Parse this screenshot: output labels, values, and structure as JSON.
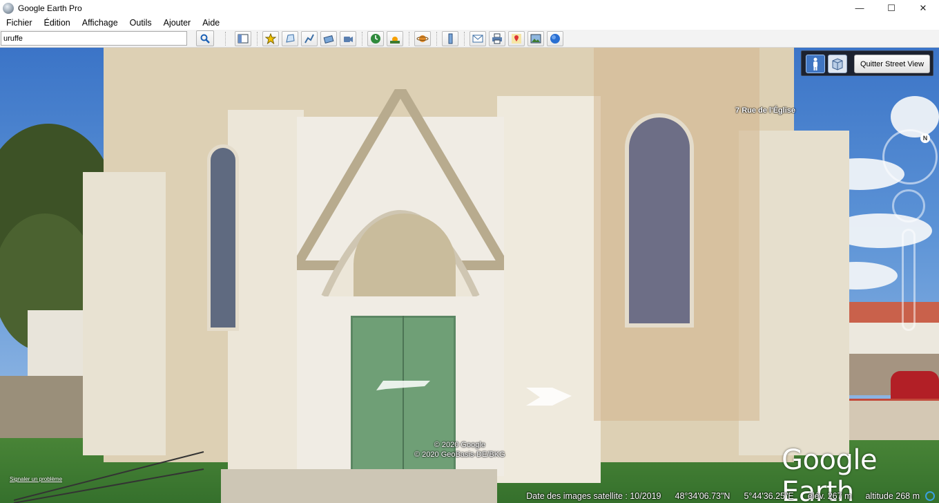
{
  "window": {
    "title": "Google Earth Pro",
    "minimize": "—",
    "maximize": "☐",
    "close": "✕"
  },
  "menu": [
    {
      "label": "Fichier"
    },
    {
      "label": "Édition"
    },
    {
      "label": "Affichage"
    },
    {
      "label": "Outils"
    },
    {
      "label": "Ajouter"
    },
    {
      "label": "Aide"
    }
  ],
  "search": {
    "value": "uruffe",
    "icon": "magnifier-icon"
  },
  "toolbar_icons": [
    "sidebar-toggle-icon",
    "placemark-icon",
    "polygon-icon",
    "path-icon",
    "overlay-icon",
    "tour-icon",
    "historical-imagery-icon",
    "sunlight-icon",
    "planets-icon",
    "ruler-icon",
    "email-icon",
    "print-icon",
    "google-maps-icon",
    "save-image-icon",
    "earth-gallery-icon"
  ],
  "streetview": {
    "address": "7 Rue de l'Église",
    "quit_label": "Quitter Street View",
    "north_label": "N"
  },
  "imagery": {
    "copyright_line1": "© 2020 Google",
    "copyright_line2": "© 2020 GeoBasis-DE/BKG",
    "logo": "Google Earth",
    "report_link": "Signaler un problème"
  },
  "status": {
    "imagery_date": "Date des images satellite : 10/2019",
    "latitude": "48°34'06.73\"N",
    "longitude": "5°44'36.25\"E",
    "elevation": "élév.   267 m",
    "altitude": "altitude   268 m"
  },
  "colors": {
    "door": "#6f9f76",
    "stone": "#e6dfcf",
    "sky": "#3b74c7"
  }
}
